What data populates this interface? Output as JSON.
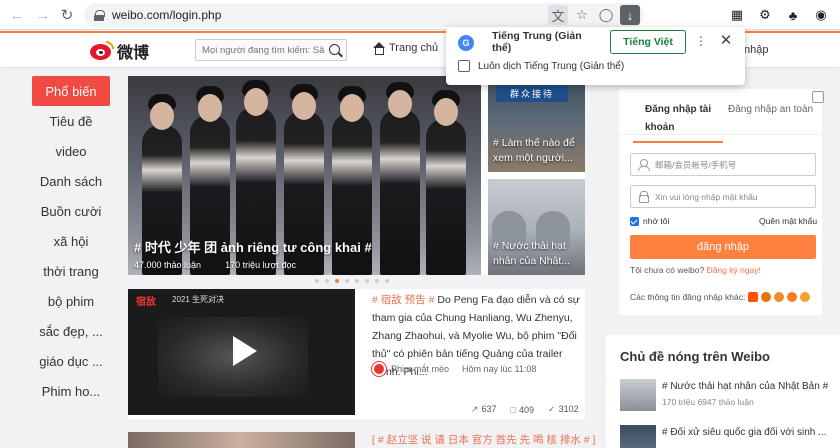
{
  "browser": {
    "url": "weibo.com/login.php"
  },
  "header": {
    "logo_text": "微博",
    "search_placeholder": "Mọi người đang tìm kiếm: Săn...",
    "home_label": "Trang chủ",
    "login_label": "nhập"
  },
  "sidebar": {
    "items": [
      {
        "label": "Phổ biến",
        "active": true
      },
      {
        "label": "Tiêu đề"
      },
      {
        "label": "video"
      },
      {
        "label": "Danh sách"
      },
      {
        "label": "Buồn cười"
      },
      {
        "label": "xã hội"
      },
      {
        "label": "thời trang"
      },
      {
        "label": "bộ phim"
      },
      {
        "label": "sắc đẹp, ..."
      },
      {
        "label": "giáo dục ..."
      },
      {
        "label": "Phim ho..."
      }
    ]
  },
  "carousel": {
    "hero_title": "# 时代 少年 团 ảnh riêng tư công khai #",
    "hero_discussions": "47.000 thảo luận",
    "hero_views": "170 triệu lượt đọc",
    "thumb1_sign": "群众接待",
    "thumb1_caption": "# Làm thế nào để xem một người...",
    "thumb2_caption": "# Nước thải hạt nhân của Nhật..."
  },
  "feed": {
    "video_badge": "宿敌",
    "video_badge_sub": "2021 生死对决",
    "tags": "# 宿敌 预告 #",
    "text": " Do Peng Fa đạo diễn và có sự tham gia của Chung Hanliang, Wu Zhenyu, Zhang Zhaohui, và Myolie Wu, bộ phim \"Đối thủ\" có phiên bản tiếng Quảng của trailer chính. Phi...",
    "author": "Phim mắt mèo",
    "time": "Hôm nay lúc 11:08",
    "shares": "637",
    "comments": "409",
    "likes": "3102",
    "next_tags": "[ # 赵立坚 说 请 日本 官方 首先 先 喝 核 排水 # ]"
  },
  "login": {
    "tab_account": "Đăng nhập tài khoản",
    "tab_secure": "Đăng nhập an toàn",
    "username_placeholder": "邮箱/会员帐号/手机号",
    "password_placeholder": "Xin vui lòng nhập mật khẩu",
    "remember": "nhớ tôi",
    "forgot": "Quên mật khẩu",
    "submit": "đăng nhập",
    "no_account": "Tôi chưa có weibo? ",
    "register": "Đăng ký ngay!",
    "other_methods": "Các thông tin đăng nhập khác:"
  },
  "hot": {
    "title": "Chủ đề nóng trên Weibo",
    "items": [
      {
        "name": "# Nước thải hạt nhân của Nhật Bản #",
        "meta": "170 triệu 6947 thảo luận"
      },
      {
        "name": "# Đối xử siêu quốc gia đối với sinh ...",
        "meta": ""
      }
    ]
  },
  "translate": {
    "source_lang": "Tiếng Trung (Giản thể)",
    "target_lang": "Tiếng Việt",
    "always_translate": "Luôn dịch Tiếng Trung (Giản thể)"
  }
}
